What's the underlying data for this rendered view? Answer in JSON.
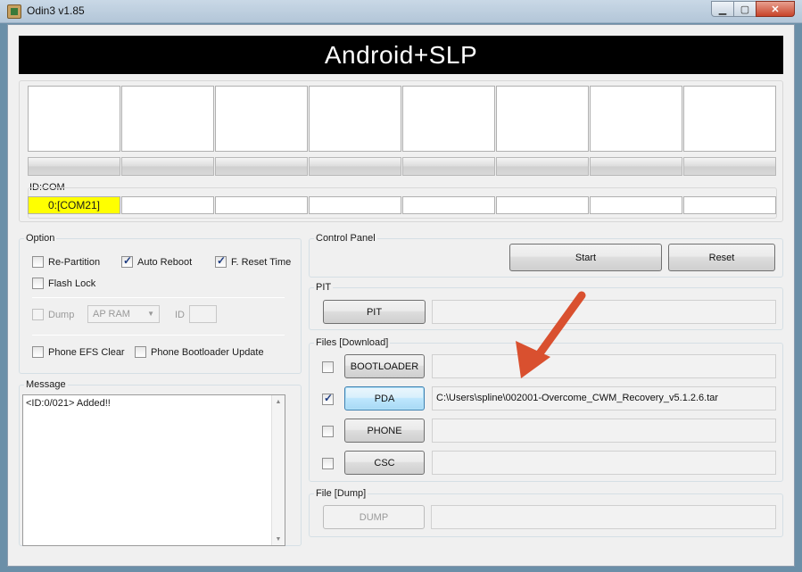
{
  "window": {
    "title": "Odin3 v1.85"
  },
  "banner": "Android+SLP",
  "slots": {
    "count": 8
  },
  "idcom": {
    "label": "ID:COM",
    "values": [
      "0:[COM21]",
      "",
      "",
      "",
      "",
      "",
      "",
      ""
    ]
  },
  "option": {
    "legend": "Option",
    "re_partition": {
      "label": "Re-Partition",
      "checked": false
    },
    "auto_reboot": {
      "label": "Auto Reboot",
      "checked": true
    },
    "f_reset_time": {
      "label": "F. Reset Time",
      "checked": true
    },
    "flash_lock": {
      "label": "Flash Lock",
      "checked": false
    },
    "dump": {
      "label": "Dump",
      "checked": false
    },
    "dump_source": "AP RAM",
    "id_label": "ID",
    "phone_efs_clear": {
      "label": "Phone EFS Clear",
      "checked": false
    },
    "phone_bootloader_update": {
      "label": "Phone Bootloader Update",
      "checked": false
    }
  },
  "message": {
    "legend": "Message",
    "text": "<ID:0/021> Added!!"
  },
  "control_panel": {
    "legend": "Control Panel",
    "start_label": "Start",
    "reset_label": "Reset"
  },
  "pit": {
    "legend": "PIT",
    "button_label": "PIT",
    "path": ""
  },
  "files": {
    "legend": "Files [Download]",
    "bootloader": {
      "label": "BOOTLOADER",
      "checked": false,
      "path": ""
    },
    "pda": {
      "label": "PDA",
      "checked": true,
      "path": "C:\\Users\\spline\\002001-Overcome_CWM_Recovery_v5.1.2.6.tar"
    },
    "phone": {
      "label": "PHONE",
      "checked": false,
      "path": ""
    },
    "csc": {
      "label": "CSC",
      "checked": false,
      "path": ""
    }
  },
  "dump_group": {
    "legend": "File [Dump]",
    "button_label": "DUMP",
    "path": ""
  },
  "colors": {
    "banner_bg": "#000000",
    "active_port": "#ffff00",
    "annotation_arrow": "#d9502f"
  }
}
